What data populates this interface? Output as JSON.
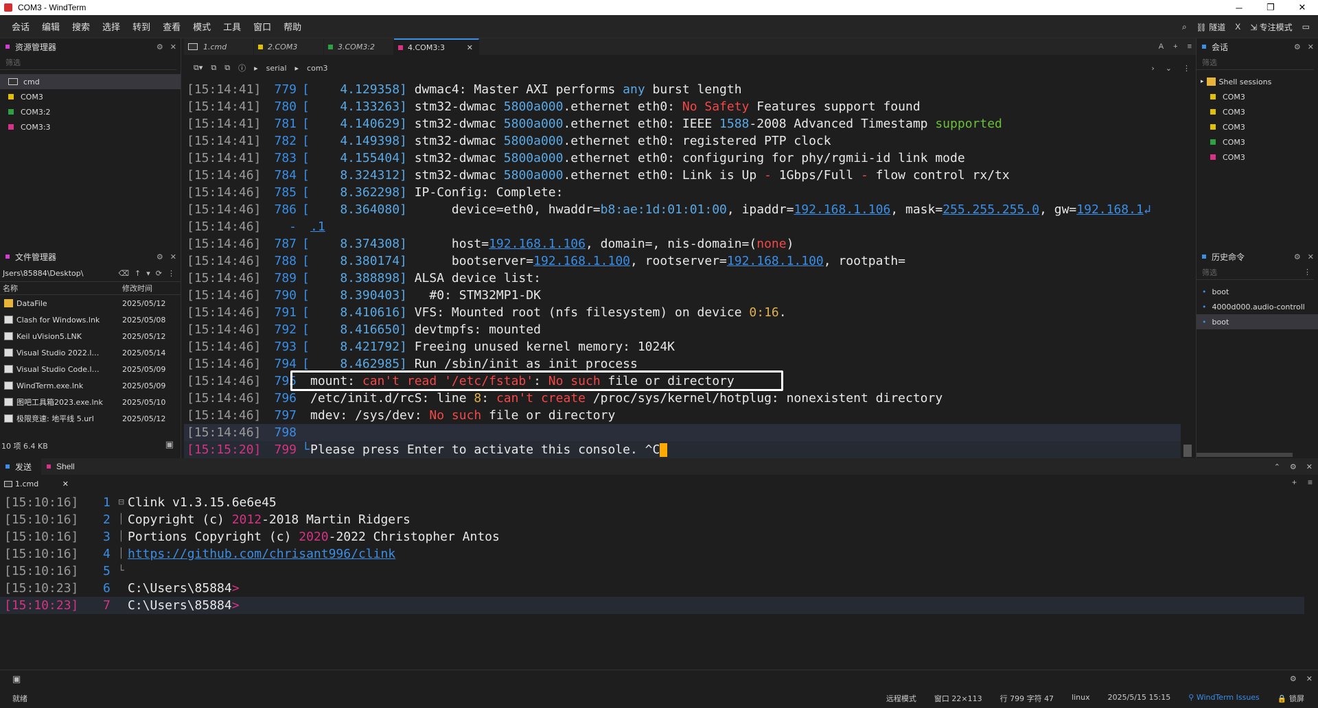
{
  "window": {
    "title": "COM3 - WindTerm",
    "minimize": "─",
    "maximize": "❐",
    "close": "✕"
  },
  "menu": {
    "items": [
      "会话",
      "编辑",
      "搜索",
      "选择",
      "转到",
      "查看",
      "模式",
      "工具",
      "窗口",
      "帮助"
    ],
    "right": {
      "search_icon": "⌕",
      "tunnel": "⛓ 隧道",
      "x": "X",
      "focus_mode": "⇲ 专注模式",
      "layout_icon": "▭"
    }
  },
  "explorer": {
    "title": "资源管理器",
    "filter": "筛选",
    "items": [
      {
        "label": "cmd",
        "color": ""
      },
      {
        "label": "COM3",
        "color": "#e0c000"
      },
      {
        "label": "COM3:2",
        "color": "#2ea043"
      },
      {
        "label": "COM3:3",
        "color": "#d63384"
      }
    ]
  },
  "filemanager": {
    "title": "文件管理器",
    "path": "Jsers\\85884\\Desktop\\",
    "col_name": "名称",
    "col_date": "修改时间",
    "files": [
      {
        "name": "DataFile",
        "date": "2025/05/12",
        "type": "folder"
      },
      {
        "name": "Clash for Windows.lnk",
        "date": "2025/05/08",
        "type": "lnk"
      },
      {
        "name": "Keil uVision5.LNK",
        "date": "2025/05/12",
        "type": "lnk"
      },
      {
        "name": "Visual Studio 2022.l…",
        "date": "2025/05/14",
        "type": "lnk"
      },
      {
        "name": "Visual Studio Code.l…",
        "date": "2025/05/09",
        "type": "lnk"
      },
      {
        "name": "WindTerm.exe.lnk",
        "date": "2025/05/09",
        "type": "lnk"
      },
      {
        "name": "图吧工具箱2023.exe.lnk",
        "date": "2025/05/10",
        "type": "lnk"
      },
      {
        "name": "极限竞速: 地平线 5.url",
        "date": "2025/05/12",
        "type": "lnk"
      }
    ],
    "footer": "10 项 6.4 KB"
  },
  "tabs": [
    {
      "label": "1.cmd",
      "color": ""
    },
    {
      "label": "2.COM3",
      "color": "#e0c000"
    },
    {
      "label": "3.COM3:2",
      "color": "#2ea043"
    },
    {
      "label": "4.COM3:3",
      "color": "#d63384",
      "active": true
    }
  ],
  "tabs_right": {
    "a": "A",
    "plus": "+",
    "menu": "≡"
  },
  "breadcrumb": {
    "serial": "serial",
    "com": "com3"
  },
  "terminal": {
    "lines": [
      {
        "ts": "[15:14:41]",
        "ln": "779",
        "t": "4.129358",
        "parts": [
          [
            "dwmac4: Master AXI performs ",
            ""
          ],
          [
            "any",
            "c-blue"
          ],
          [
            " burst length",
            ""
          ]
        ]
      },
      {
        "ts": "[15:14:41]",
        "ln": "780",
        "t": "4.133263",
        "parts": [
          [
            "stm32-dwmac ",
            ""
          ],
          [
            "5800a000",
            "c-blue"
          ],
          [
            ".ethernet eth0: ",
            ""
          ],
          [
            "No Safety",
            "c-red"
          ],
          [
            " Features support found",
            ""
          ]
        ]
      },
      {
        "ts": "[15:14:41]",
        "ln": "781",
        "t": "4.140629",
        "parts": [
          [
            "stm32-dwmac ",
            ""
          ],
          [
            "5800a000",
            "c-blue"
          ],
          [
            ".ethernet eth0: IEEE ",
            ""
          ],
          [
            "1588",
            "c-blue"
          ],
          [
            "-2008 Advanced Timestamp ",
            ""
          ],
          [
            "supported",
            "c-green"
          ]
        ]
      },
      {
        "ts": "[15:14:41]",
        "ln": "782",
        "t": "4.149398",
        "parts": [
          [
            "stm32-dwmac ",
            ""
          ],
          [
            "5800a000",
            "c-blue"
          ],
          [
            ".ethernet eth0: registered PTP clock",
            ""
          ]
        ]
      },
      {
        "ts": "[15:14:41]",
        "ln": "783",
        "t": "4.155404",
        "parts": [
          [
            "stm32-dwmac ",
            ""
          ],
          [
            "5800a000",
            "c-blue"
          ],
          [
            ".ethernet eth0: configuring for phy/rgmii-id link mode",
            ""
          ]
        ]
      },
      {
        "ts": "[15:14:46]",
        "ln": "784",
        "t": "8.324312",
        "parts": [
          [
            "stm32-dwmac ",
            ""
          ],
          [
            "5800a000",
            "c-blue"
          ],
          [
            ".ethernet eth0: Link is Up ",
            ""
          ],
          [
            "-",
            "c-red"
          ],
          [
            " 1Gbps/Full ",
            ""
          ],
          [
            "-",
            "c-red"
          ],
          [
            " flow control rx/tx",
            ""
          ]
        ]
      },
      {
        "ts": "[15:14:46]",
        "ln": "785",
        "t": "8.362298",
        "parts": [
          [
            "IP-Config: Complete:",
            ""
          ]
        ]
      },
      {
        "ts": "[15:14:46]",
        "ln": "786",
        "t": "8.364080",
        "parts": [
          [
            "     device=eth0, hwaddr=",
            ""
          ],
          [
            "b8:ae:1d:01:01:00",
            "c-blue"
          ],
          [
            ", ipaddr=",
            ""
          ],
          [
            "192.168.1.106",
            "c-link"
          ],
          [
            ", mask=",
            ""
          ],
          [
            "255.255.255.0",
            "c-link"
          ],
          [
            ", gw=",
            ""
          ],
          [
            "192.168.1",
            "c-link"
          ],
          [
            "↲",
            "c-lblue"
          ]
        ]
      },
      {
        "ts": "[15:14:46]",
        "ln": "-",
        "t": "",
        "cont": ".1"
      },
      {
        "ts": "[15:14:46]",
        "ln": "787",
        "t": "8.374308",
        "parts": [
          [
            "     host=",
            ""
          ],
          [
            "192.168.1.106",
            "c-link"
          ],
          [
            ", domain=, nis-domain=(",
            ""
          ],
          [
            "none",
            "c-red"
          ],
          [
            ")",
            ""
          ]
        ]
      },
      {
        "ts": "[15:14:46]",
        "ln": "788",
        "t": "8.380174",
        "parts": [
          [
            "     bootserver=",
            ""
          ],
          [
            "192.168.1.100",
            "c-link"
          ],
          [
            ", rootserver=",
            ""
          ],
          [
            "192.168.1.100",
            "c-link"
          ],
          [
            ", rootpath=",
            ""
          ]
        ]
      },
      {
        "ts": "[15:14:46]",
        "ln": "789",
        "t": "8.388898",
        "parts": [
          [
            "ALSA device list:",
            ""
          ]
        ]
      },
      {
        "ts": "[15:14:46]",
        "ln": "790",
        "t": "8.390403",
        "parts": [
          [
            "  #0: STM32MP1-DK",
            ""
          ]
        ]
      },
      {
        "ts": "[15:14:46]",
        "ln": "791",
        "t": "8.410616",
        "parts": [
          [
            "VFS: Mounted root (nfs filesystem) on device ",
            ""
          ],
          [
            "0:16",
            "c-orange"
          ],
          [
            ".",
            ""
          ]
        ]
      },
      {
        "ts": "[15:14:46]",
        "ln": "792",
        "t": "8.416650",
        "parts": [
          [
            "devtmpfs: mounted",
            ""
          ]
        ]
      },
      {
        "ts": "[15:14:46]",
        "ln": "793",
        "t": "8.421792",
        "parts": [
          [
            "Freeing unused kernel memory: 1024K",
            ""
          ]
        ]
      },
      {
        "ts": "[15:14:46]",
        "ln": "794",
        "t": "8.462985",
        "parts": [
          [
            "Run /sbin/init as init process",
            ""
          ]
        ]
      },
      {
        "ts": "[15:14:46]",
        "ln": "795",
        "t": "",
        "plain": [
          [
            "mount: ",
            ""
          ],
          [
            "can't read '/etc/fstab'",
            "c-red"
          ],
          [
            ": ",
            ""
          ],
          [
            "No such",
            "c-red"
          ],
          [
            " file or directory",
            ""
          ]
        ]
      },
      {
        "ts": "[15:14:46]",
        "ln": "796",
        "t": "",
        "plain": [
          [
            "/etc/init.d/rcS: line ",
            ""
          ],
          [
            "8",
            "c-orange"
          ],
          [
            ": ",
            ""
          ],
          [
            "can't create",
            "c-red"
          ],
          [
            " /proc/sys/kernel/hotplug: nonexistent directory",
            ""
          ]
        ]
      },
      {
        "ts": "[15:14:46]",
        "ln": "797",
        "t": "",
        "plain": [
          [
            "mdev: /sys/dev: ",
            ""
          ],
          [
            "No such",
            "c-red"
          ],
          [
            " file or directory",
            ""
          ]
        ]
      },
      {
        "ts": "[15:14:46]",
        "ln": "798",
        "t": "",
        "plain": [
          [
            "",
            ""
          ]
        ],
        "hl": true
      },
      {
        "ts": "[15:15:20]",
        "ln": "799",
        "t": "",
        "plain": [
          [
            "Please press Enter to activate this console. ^C",
            ""
          ]
        ],
        "cur": true
      }
    ]
  },
  "sessions": {
    "title": "会话",
    "filter": "筛选",
    "group": "Shell sessions",
    "items": [
      {
        "label": "COM3",
        "color": "#e0c000"
      },
      {
        "label": "COM3",
        "color": "#e0c000"
      },
      {
        "label": "COM3",
        "color": "#e0c000"
      },
      {
        "label": "COM3",
        "color": "#2ea043"
      },
      {
        "label": "COM3",
        "color": "#d63384"
      }
    ]
  },
  "history": {
    "title": "历史命令",
    "filter": "筛选",
    "items": [
      "boot",
      "4000d000.audio-controll",
      "boot"
    ]
  },
  "bottom": {
    "tab_send": "发送",
    "tab_shell": "Shell",
    "shell_tab": "1.cmd",
    "lines": [
      {
        "ts": "[15:10:16]",
        "ln": "1",
        "parts": [
          [
            "Clink v1.3.15.6e6e45",
            ""
          ]
        ]
      },
      {
        "ts": "[15:10:16]",
        "ln": "2",
        "parts": [
          [
            "Copyright (c) ",
            ""
          ],
          [
            "2012",
            "c-magenta"
          ],
          [
            "-2018 Martin Ridgers",
            ""
          ]
        ]
      },
      {
        "ts": "[15:10:16]",
        "ln": "3",
        "parts": [
          [
            "Portions Copyright (c) ",
            ""
          ],
          [
            "2020",
            "c-magenta"
          ],
          [
            "-2022 Christopher Antos",
            ""
          ]
        ]
      },
      {
        "ts": "[15:10:16]",
        "ln": "4",
        "parts": [
          [
            "https://github.com/chrisant996/clink",
            "c-link"
          ]
        ]
      },
      {
        "ts": "[15:10:16]",
        "ln": "5",
        "parts": [
          [
            "",
            ""
          ]
        ]
      },
      {
        "ts": "[15:10:23]",
        "ln": "6",
        "parts": [
          [
            "C:\\Users\\85884",
            ""
          ],
          [
            ">",
            "c-magenta"
          ]
        ]
      },
      {
        "ts": "[15:10:23]",
        "ln": "7",
        "parts": [
          [
            "C:\\Users\\85884",
            ""
          ],
          [
            ">",
            "c-magenta"
          ]
        ],
        "cur": true
      }
    ]
  },
  "status": {
    "ready": "就绪",
    "remote_mode": "远程模式",
    "window": "窗口 22×113",
    "position": "行 799 字符 47",
    "os": "linux",
    "datetime": "2025/5/15 15:15",
    "issues": "WindTerm Issues",
    "lock": "🔒 锁屏"
  }
}
